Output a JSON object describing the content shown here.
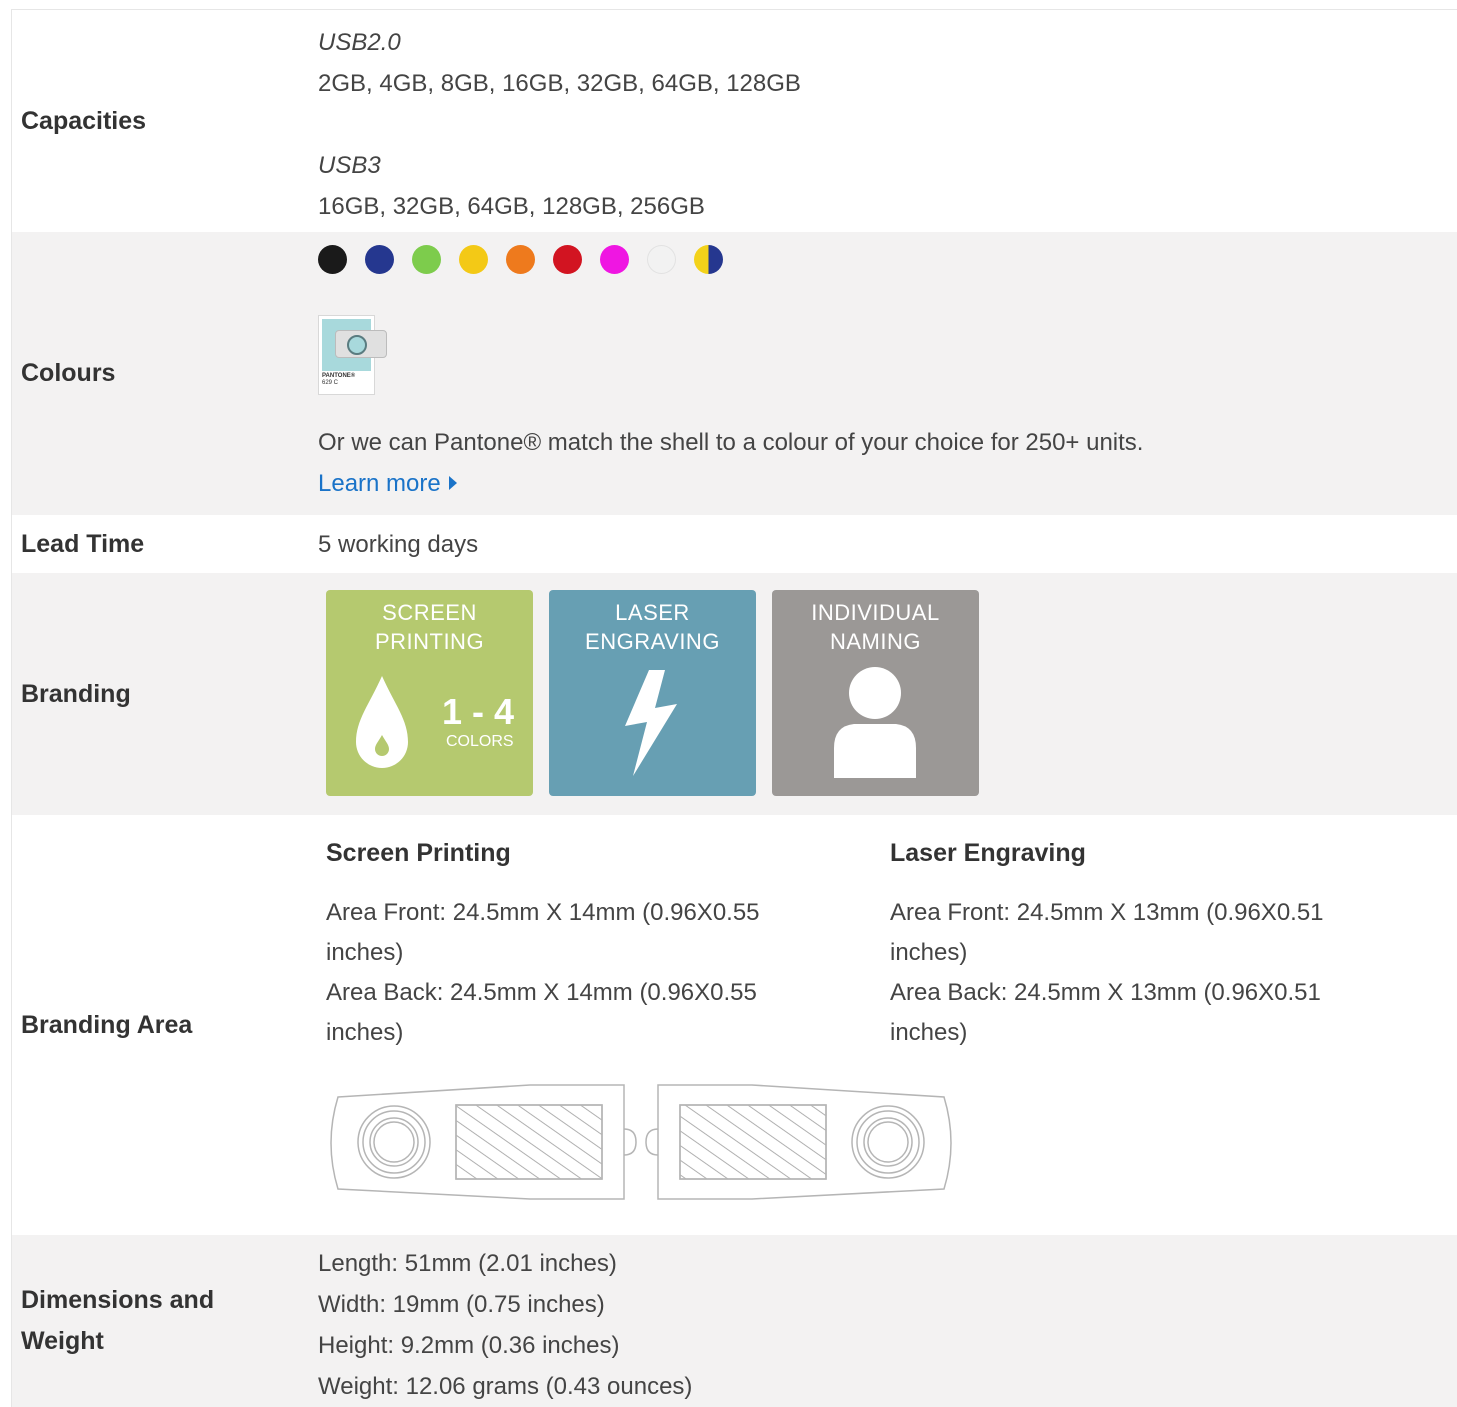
{
  "capacities": {
    "label": "Capacities",
    "usb2_type": "USB2.0",
    "usb2_sizes": "2GB, 4GB, 8GB, 16GB, 32GB, 64GB, 128GB",
    "usb3_type": "USB3",
    "usb3_sizes": "16GB, 32GB, 64GB, 128GB, 256GB"
  },
  "colours": {
    "label": "Colours",
    "swatches": [
      "#1a1a1a",
      "#25378f",
      "#7dcc4c",
      "#f3c916",
      "#ee7a1d",
      "#d21421",
      "#ef16e2",
      "#f2f2f2",
      "#f3d21a"
    ],
    "pantone_name": "PANTONE®",
    "pantone_code": "629 C",
    "pantone_text": "Or we can Pantone® match the shell to a colour of your choice for 250+ units.",
    "learn_more": "Learn more"
  },
  "lead_time": {
    "label": "Lead Time",
    "value": "5 working days"
  },
  "branding": {
    "label": "Branding",
    "tiles": [
      {
        "line1": "SCREEN",
        "line2": "PRINTING",
        "color": "#b5c96f",
        "badge_number": "1 - 4",
        "badge_text": "COLORS"
      },
      {
        "line1": "LASER",
        "line2": "ENGRAVING",
        "color": "#679fb3"
      },
      {
        "line1": "INDIVIDUAL",
        "line2": "NAMING",
        "color": "#9b9896"
      }
    ]
  },
  "branding_area": {
    "label": "Branding Area",
    "screen_printing": {
      "title": "Screen Printing",
      "front_a": "Area Front: 24.5mm X 14mm (0.96X0.55",
      "front_b": "inches)",
      "back_a": "Area Back: 24.5mm X 14mm (0.96X0.55",
      "back_b": "inches)"
    },
    "laser_engraving": {
      "title": "Laser Engraving",
      "front_a": "Area Front: 24.5mm X 13mm (0.96X0.51",
      "front_b": "inches)",
      "back_a": "Area Back: 24.5mm X 13mm (0.96X0.51",
      "back_b": "inches)"
    }
  },
  "dimensions": {
    "label_line1": "Dimensions and",
    "label_line2": "Weight",
    "length": "Length: 51mm (2.01 inches)",
    "width": "Width: 19mm (0.75 inches)",
    "height": "Height: 9.2mm (0.36 inches)",
    "weight": "Weight: 12.06 grams (0.43 ounces)"
  }
}
